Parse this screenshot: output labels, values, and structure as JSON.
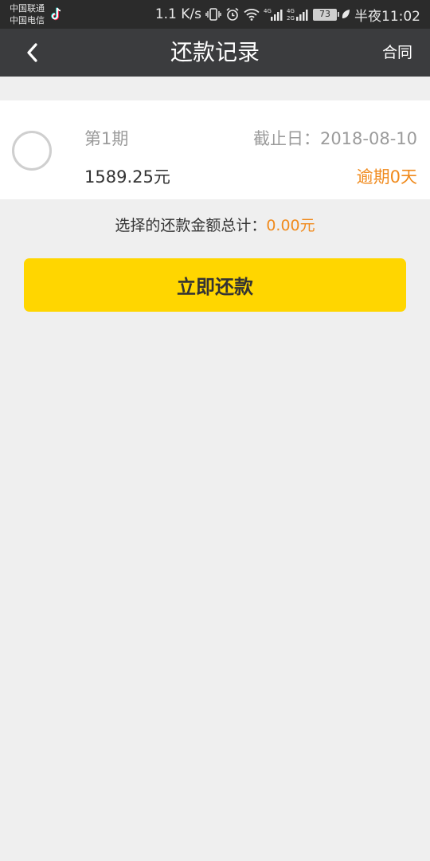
{
  "status_bar": {
    "carrier_1": "中国联通",
    "carrier_2": "中国电信",
    "net_speed": "1.1 K/s",
    "battery": "73",
    "time": "半夜11:02",
    "icons": [
      "tiktok-icon",
      "vibrate-icon",
      "alarm-icon",
      "wifi-icon",
      "signal-4g-icon",
      "signal-4g-2-icon",
      "battery-icon",
      "leaf-icon"
    ]
  },
  "header": {
    "title": "还款记录",
    "right_action": "合同",
    "back_icon": "chevron-left-icon"
  },
  "installment": {
    "period": "第1期",
    "due_date": "截止日：2018-08-10",
    "amount": "1589.25元",
    "overdue": "逾期0天",
    "selected": false
  },
  "summary": {
    "label": "选择的还款金额总计：",
    "total": "0.00元"
  },
  "pay_button": "立即还款",
  "colors": {
    "accent_yellow": "#ffd600",
    "accent_orange": "#f08a1c",
    "header_bg": "#3b3c3e",
    "status_bg": "#2b2b2b"
  }
}
